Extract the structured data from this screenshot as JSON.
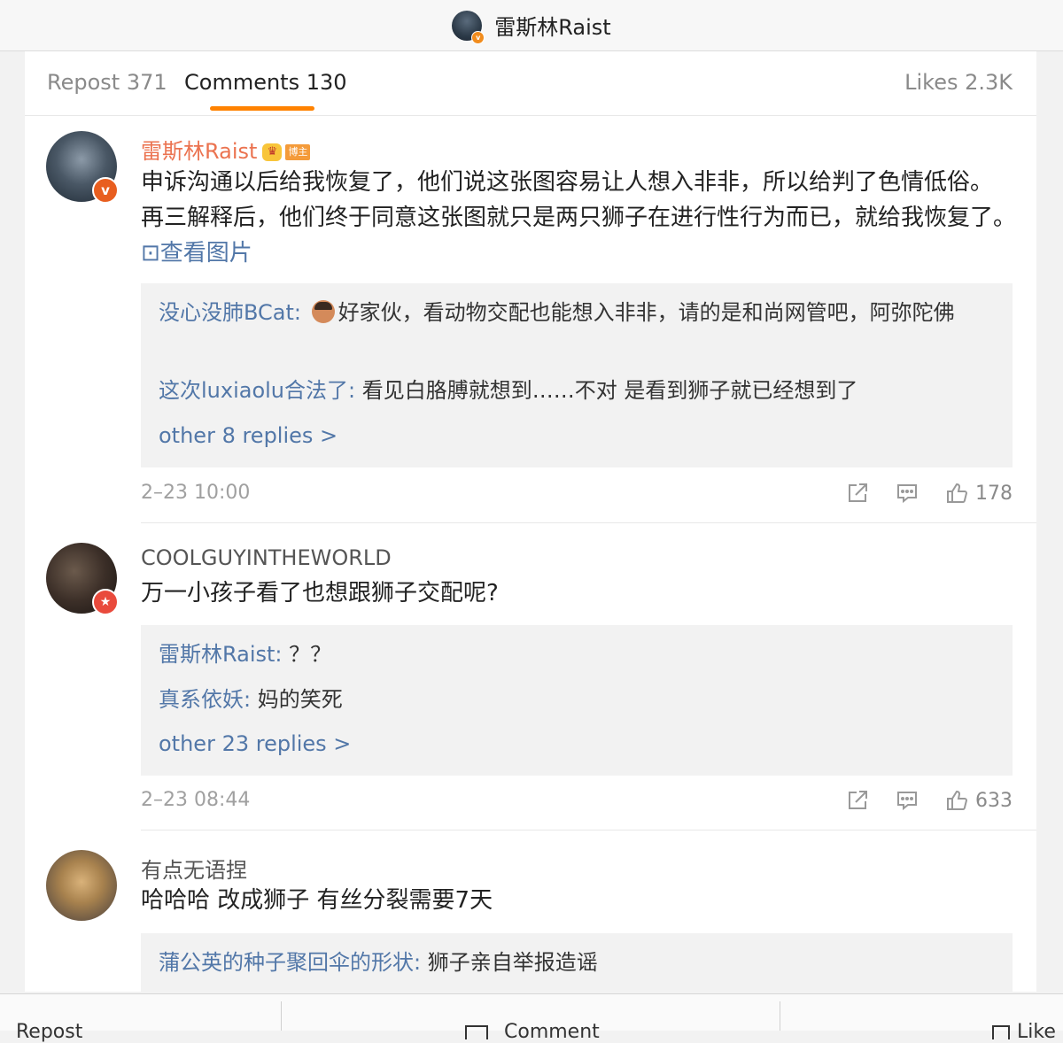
{
  "header": {
    "title": "雷斯林Raist"
  },
  "tabs": {
    "repost": "Repost 371",
    "comments": "Comments 130",
    "likes": "Likes 2.3K"
  },
  "comments": [
    {
      "username": "雷斯林Raist",
      "badge": "博主",
      "text_before": "申诉沟通以后给我恢复了，他们说这张图容易让人想入非非，所以给判了色情低俗。 再三解释后，他们终于同意这张图就只是两只狮子在进行性行为而已，就给我恢复了。 ",
      "link": "⊡查看图片",
      "replies": [
        {
          "name": "没心没肺BCat:",
          "text": "好家伙，看动物交配也能想入非非，请的是和尚网管吧，阿弥陀佛"
        },
        {
          "name": "这次luxiaolu合法了:",
          "text": " 看见白胳膊就想到……不对 是看到狮子就已经想到了"
        }
      ],
      "more": "other 8 replies >",
      "time": "2–23 10:00",
      "likes": "178"
    },
    {
      "username": "COOLGUYINTHEWORLD",
      "text": "万一小孩子看了也想跟狮子交配呢?",
      "replies": [
        {
          "name": "雷斯林Raist:",
          "text": " ？？"
        },
        {
          "name": "真系依妖:",
          "text": " 妈的笑死"
        }
      ],
      "more": "other 23 replies >",
      "time": "2–23 08:44",
      "likes": "633"
    },
    {
      "username": "有点无语捏",
      "text": "哈哈哈  改成狮子 有丝分裂需要7天",
      "replies": [
        {
          "name": "蒲公英的种子聚回伞的形状:",
          "text": " 狮子亲自举报造谣"
        }
      ]
    }
  ],
  "bottom_bar": {
    "repost": "Repost",
    "comment": "Comment",
    "like": "Like"
  },
  "colors": {
    "accent": "#ff8200",
    "link": "#5277a8",
    "username_highlight": "#eb7350"
  }
}
